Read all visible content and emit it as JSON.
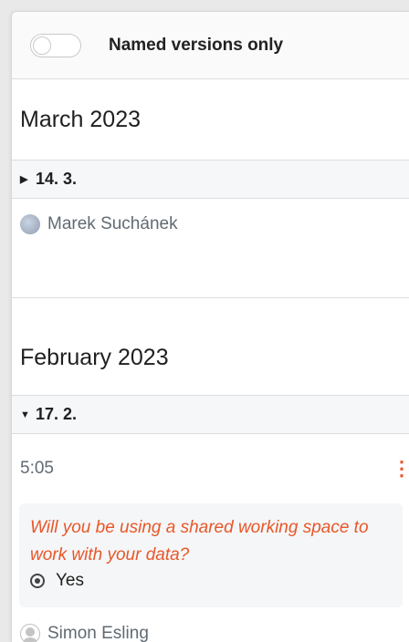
{
  "filter": {
    "toggle_label": "Named versions only",
    "toggle_on": false
  },
  "groups": [
    {
      "month": "March 2023",
      "days": [
        {
          "label": "14. 3.",
          "expanded": false,
          "author": "Marek Suchánek"
        }
      ]
    },
    {
      "month": "February 2023",
      "days": [
        {
          "label": "17. 2.",
          "expanded": true,
          "time": "5:05",
          "question": "Will you be using a shared working space to work with your data?",
          "answer": "Yes",
          "author": "Simon Esling"
        }
      ]
    }
  ],
  "icons": {
    "collapsed_caret": "▶",
    "expanded_caret": "▼",
    "kebab": "⋮"
  },
  "colors": {
    "accent": "#e8572a",
    "muted_text": "#606a73"
  }
}
